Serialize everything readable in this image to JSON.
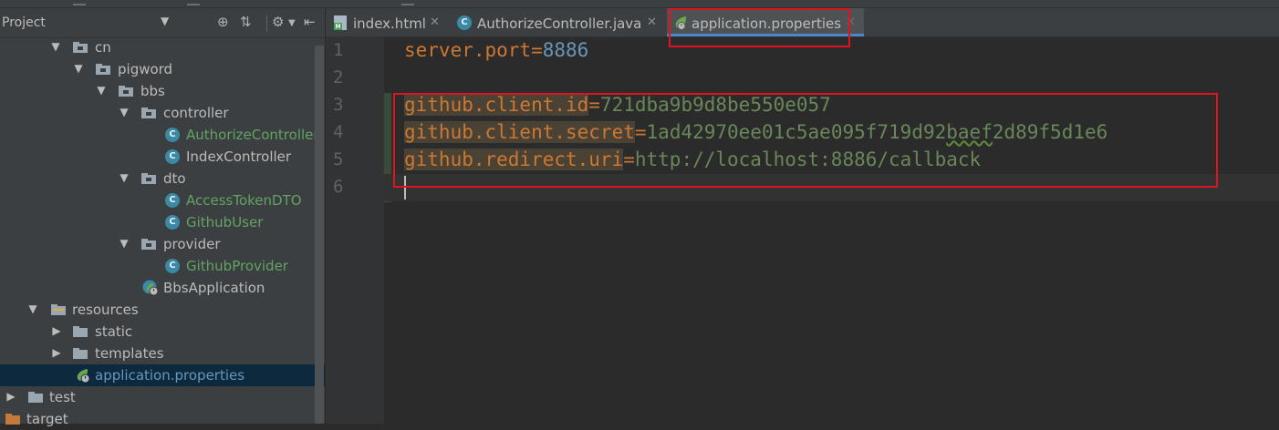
{
  "project_panel": {
    "title": "Project",
    "dropdown_icon": "caret-down-icon",
    "toolbar_icons": [
      "locate-icon",
      "collapse-all-icon",
      "settings-icon",
      "hide-panel-icon"
    ],
    "tree": [
      {
        "label": "cn",
        "type": "package",
        "expanded": true
      },
      {
        "label": "pigword",
        "type": "package",
        "expanded": true
      },
      {
        "label": "bbs",
        "type": "package",
        "expanded": true
      },
      {
        "label": "controller",
        "type": "package",
        "expanded": true
      },
      {
        "label": "AuthorizeController",
        "type": "class",
        "color": "green"
      },
      {
        "label": "IndexController",
        "type": "class",
        "color": "default"
      },
      {
        "label": "dto",
        "type": "package",
        "expanded": true
      },
      {
        "label": "AccessTokenDTO",
        "type": "class",
        "color": "green"
      },
      {
        "label": "GithubUser",
        "type": "class",
        "color": "green"
      },
      {
        "label": "provider",
        "type": "package",
        "expanded": true
      },
      {
        "label": "GithubProvider",
        "type": "class",
        "color": "green"
      },
      {
        "label": "BbsApplication",
        "type": "spring-class",
        "color": "default"
      },
      {
        "label": "resources",
        "type": "resources-folder",
        "expanded": true
      },
      {
        "label": "static",
        "type": "folder",
        "expanded": false
      },
      {
        "label": "templates",
        "type": "folder",
        "expanded": false
      },
      {
        "label": "application.properties",
        "type": "properties",
        "color": "blue",
        "selected": true
      },
      {
        "label": "test",
        "type": "folder",
        "expanded": false
      },
      {
        "label": "target",
        "type": "orange-folder",
        "expanded": false
      }
    ]
  },
  "tabs": [
    {
      "label": "index.html",
      "icon": "html-file-icon",
      "active": false
    },
    {
      "label": "AuthorizeController.java",
      "icon": "class-icon",
      "active": false
    },
    {
      "label": "application.properties",
      "icon": "spring-leaf-icon",
      "active": true
    }
  ],
  "editor": {
    "line_numbers": [
      "1",
      "2",
      "3",
      "4",
      "5",
      "6"
    ],
    "lines": [
      {
        "key": "server.port",
        "eq": "=",
        "value": "8886"
      },
      {
        "key": "",
        "eq": "",
        "value": ""
      },
      {
        "key": "github.client.id",
        "eq": "=",
        "value": "721dba9b9d8be550e057"
      },
      {
        "key": "github.client.secret",
        "eq": "=",
        "value_a": "1ad42970ee01c5ae095f719d92",
        "value_b": "baef",
        "value_c": "2d89f5d1e6"
      },
      {
        "key": "github.redirect.uri",
        "eq": "=",
        "value": "http://localhost:8886/callback"
      },
      {
        "key": "",
        "eq": "",
        "value": ""
      }
    ]
  },
  "colors": {
    "background": "#2b2b2b",
    "panel": "#3c3f41",
    "keyword": "#cc7832",
    "string": "#6a8759",
    "number": "#6897bb",
    "annotation_box": "#e0141e"
  }
}
